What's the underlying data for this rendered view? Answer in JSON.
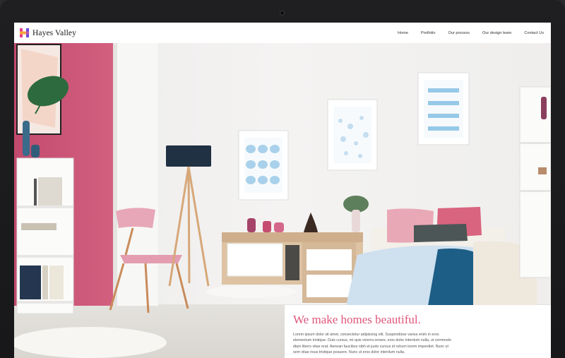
{
  "header": {
    "brand": "Hayes Valley",
    "nav": [
      "Home",
      "Portfolio",
      "Our process",
      "Our design team",
      "Contact Us"
    ]
  },
  "hero": {
    "headline": "We make homes beautiful.",
    "body": "Lorem ipsum dolor sit amet, consectetur adipiscing elit. Suspendisse varius enim in eros elementum tristique. Duis cursus, mi quis viverra ornare, eros dolor interdum nulla, ut commodo diam libero vitae erat. Aenean faucibus nibh et justo cursus id rutrum lorem imperdiet. Nunc ut sem vitae risus tristique posuere. Nunc ut eros dolor interdum nulla."
  },
  "colors": {
    "accent": "#e0567d",
    "logo_pink": "#e83e8c",
    "logo_orange": "#f7a33b",
    "logo_purple": "#6b4bd8",
    "wall_pink": "#c64d70",
    "bezel": "#1c1c1e"
  }
}
